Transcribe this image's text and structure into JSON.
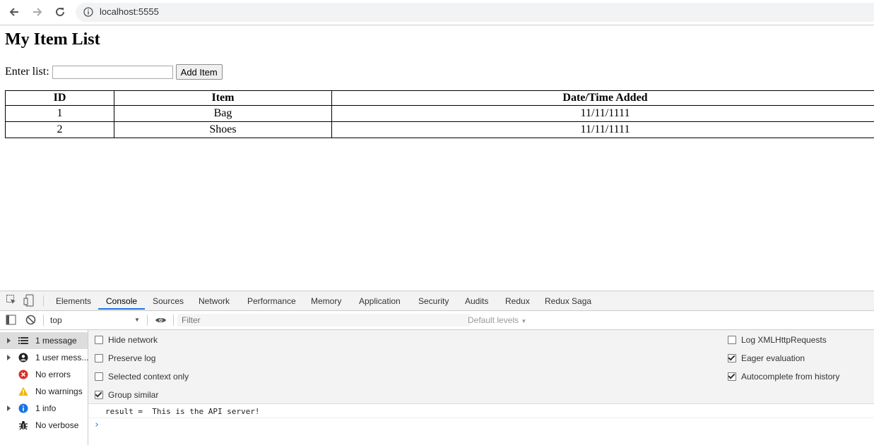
{
  "browser": {
    "url": "localhost:5555"
  },
  "page": {
    "title": "My Item List",
    "input_label": "Enter list:",
    "input_value": "",
    "add_button": "Add Item",
    "table": {
      "headers": [
        "ID",
        "Item",
        "Date/Time Added"
      ],
      "rows": [
        [
          "1",
          "Bag",
          "11/11/1111"
        ],
        [
          "2",
          "Shoes",
          "11/11/1111"
        ]
      ]
    }
  },
  "devtools": {
    "tabs": [
      "Elements",
      "Console",
      "Sources",
      "Network",
      "Performance",
      "Memory",
      "Application",
      "Security",
      "Audits",
      "Redux",
      "Redux Saga"
    ],
    "active_tab": "Console",
    "context": "top",
    "filter_placeholder": "Filter",
    "levels": "Default levels",
    "sidebar": [
      {
        "label": "1 message",
        "icon": "list-icon",
        "expandable": true,
        "selected": true
      },
      {
        "label": "1 user mess...",
        "icon": "user-icon",
        "expandable": true,
        "selected": false
      },
      {
        "label": "No errors",
        "icon": "error-icon",
        "expandable": false,
        "selected": false
      },
      {
        "label": "No warnings",
        "icon": "warning-icon",
        "expandable": false,
        "selected": false
      },
      {
        "label": "1 info",
        "icon": "info-icon",
        "expandable": true,
        "selected": false
      },
      {
        "label": "No verbose",
        "icon": "bug-icon",
        "expandable": false,
        "selected": false
      }
    ],
    "settings_left": [
      {
        "label": "Hide network",
        "checked": false
      },
      {
        "label": "Preserve log",
        "checked": false
      },
      {
        "label": "Selected context only",
        "checked": false
      },
      {
        "label": "Group similar",
        "checked": true
      }
    ],
    "settings_right": [
      {
        "label": "Log XMLHttpRequests",
        "checked": false
      },
      {
        "label": "Eager evaluation",
        "checked": true
      },
      {
        "label": "Autocomplete from history",
        "checked": true
      }
    ],
    "console_message": "result =  This is the API server!",
    "prompt_symbol": "›",
    "colors": {
      "accent": "#1a73e8",
      "error": "#d93025",
      "warning": "#f2b400",
      "info": "#1a73e8"
    }
  }
}
